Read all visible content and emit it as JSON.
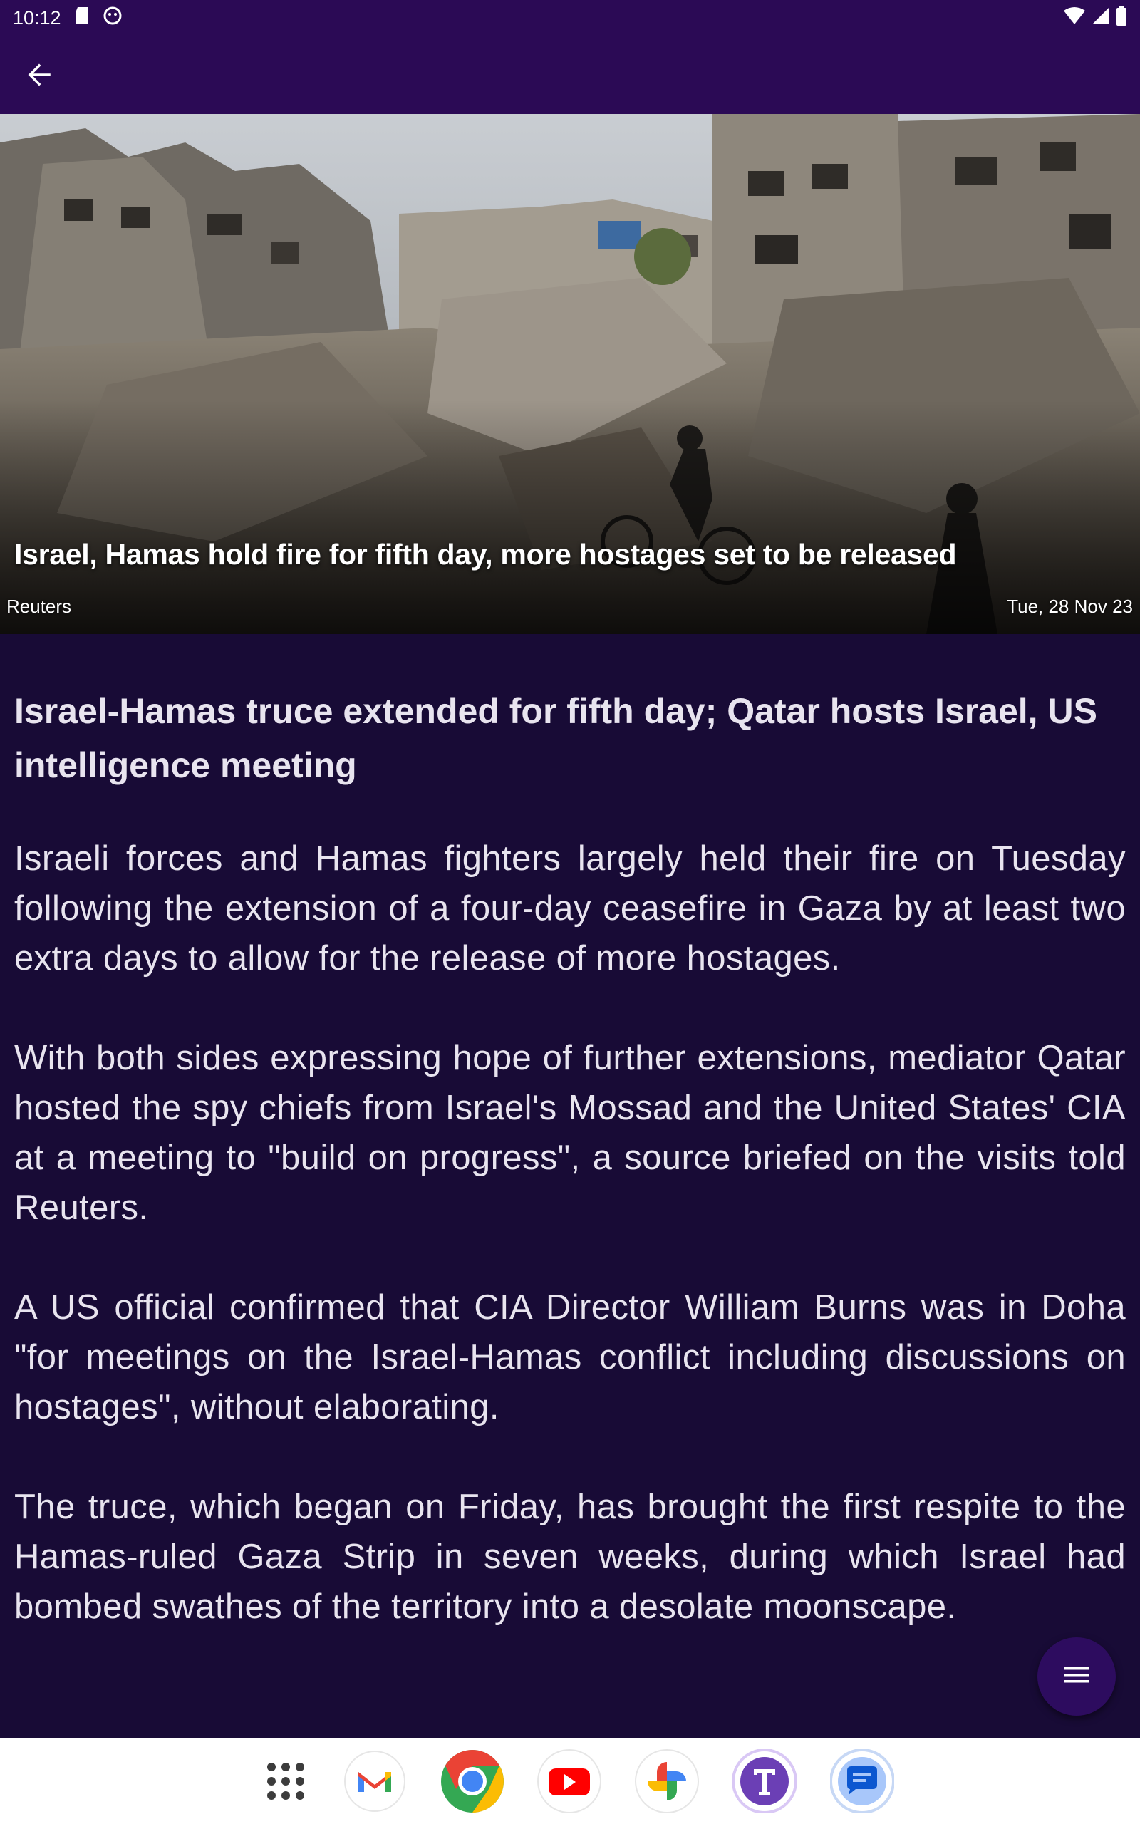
{
  "status_bar": {
    "time": "10:12"
  },
  "app_bar": {
    "back_icon": "arrow-back-icon"
  },
  "hero": {
    "title": "Israel, Hamas hold fire for fifth day, more hostages set to be released",
    "source": "Reuters",
    "date": "Tue, 28 Nov 23"
  },
  "article": {
    "headline": "Israel-Hamas truce extended for fifth day; Qatar hosts Israel, US intelligence meeting",
    "paragraphs": [
      "Israeli forces and Hamas fighters largely held their fire on Tuesday following the extension of a four-day ceasefire in Gaza by at least two extra days to allow for the release of more hostages.",
      "With both sides expressing hope of further extensions, mediator Qatar hosted the spy chiefs from Israel's Mossad and the United States' CIA at a meeting to \"build on progress\", a source briefed on the visits told Reuters.",
      "A US official confirmed that CIA Director William Burns was in Doha \"for meetings on the Israel-Hamas conflict including discussions on hostages\", without elaborating.",
      "The truce, which began on Friday, has brought the first respite to the Hamas-ruled Gaza Strip in seven weeks, during which Israel had bombed swathes of the territory into a desolate moonscape."
    ]
  },
  "fab": {
    "icon": "menu-icon"
  },
  "dock": {
    "apps": [
      "app-drawer-icon",
      "gmail-icon",
      "chrome-icon",
      "youtube-icon",
      "photos-icon",
      "text-app-icon",
      "messages-icon"
    ]
  },
  "colors": {
    "app_bar": "#2b0a55",
    "background": "#180b36",
    "fab": "#2d0c5f"
  }
}
